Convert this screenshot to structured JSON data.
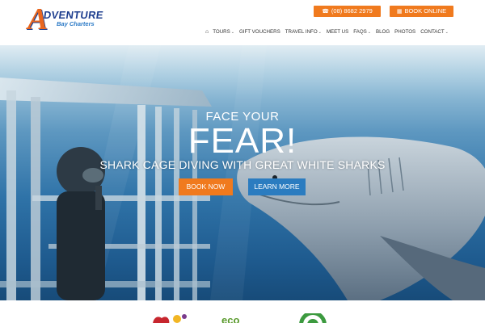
{
  "header": {
    "logo": {
      "main": "DVENTURE",
      "sub": "Bay Charters",
      "mark": "A"
    },
    "phone": {
      "label": "(08) 8682 2979",
      "icon": "phone-icon"
    },
    "book_online": {
      "label": "BOOK ONLINE",
      "icon": "calendar-icon"
    }
  },
  "nav": {
    "home_icon": "home-icon",
    "items": [
      {
        "label": "TOURS",
        "dropdown": true
      },
      {
        "label": "GIFT VOUCHERS",
        "dropdown": false
      },
      {
        "label": "TRAVEL INFO",
        "dropdown": true
      },
      {
        "label": "MEET US",
        "dropdown": false
      },
      {
        "label": "FAQS",
        "dropdown": true
      },
      {
        "label": "BLOG",
        "dropdown": false
      },
      {
        "label": "PHOTOS",
        "dropdown": false
      },
      {
        "label": "CONTACT",
        "dropdown": true
      }
    ]
  },
  "hero": {
    "line1": "FACE YOUR",
    "line2": "FEAR!",
    "line3": "SHARK CAGE DIVING WITH GREAT WHITE SHARKS",
    "book_now": "BOOK NOW",
    "learn_more": "LEARN MORE"
  },
  "partners": {
    "logo2_text": "eco"
  },
  "colors": {
    "accent_orange": "#f07a1e",
    "accent_blue": "#2b7cc0",
    "brand_navy": "#1f3f8f"
  }
}
